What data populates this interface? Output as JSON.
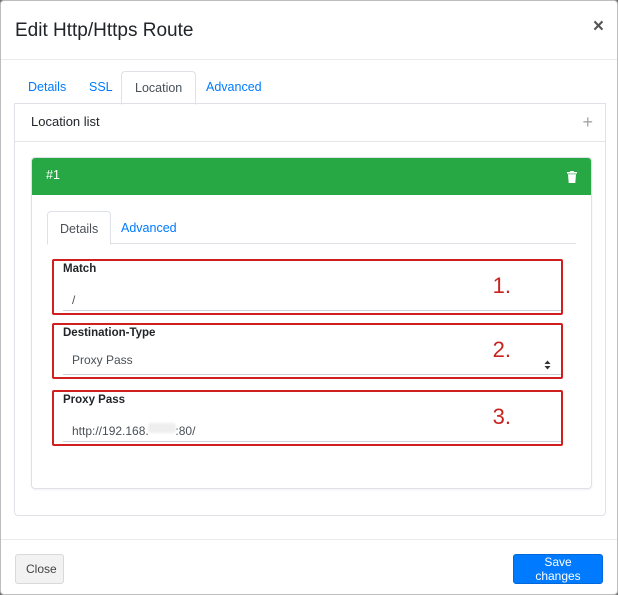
{
  "modal": {
    "title": "Edit Http/Https Route",
    "close_glyph": "×"
  },
  "tabs": [
    {
      "label": "Details"
    },
    {
      "label": "SSL"
    },
    {
      "label": "Location"
    },
    {
      "label": "Advanced"
    }
  ],
  "active_tab": "Location",
  "location_list": {
    "title": "Location list",
    "add_glyph": "+"
  },
  "location": {
    "number": "#1",
    "tabs": [
      {
        "label": "Details"
      },
      {
        "label": "Advanced"
      }
    ],
    "active_tab": "Details",
    "match": {
      "label": "Match",
      "value": "/"
    },
    "destination_type": {
      "label": "Destination-Type",
      "value": "Proxy Pass"
    },
    "proxy_pass": {
      "label": "Proxy Pass",
      "value": "http://192.168.        :80/"
    }
  },
  "annotations": [
    "1.",
    "2.",
    "3."
  ],
  "footer": {
    "close_label": "Close",
    "save_label": "Save changes"
  },
  "colors": {
    "card_header": "#28a745",
    "primary": "#007bff",
    "highlight_border": "#cf1f1f",
    "annotation": "#c9231f"
  },
  "icons": [
    "close-icon",
    "plus-icon",
    "trash-icon",
    "select-caret-icon"
  ]
}
